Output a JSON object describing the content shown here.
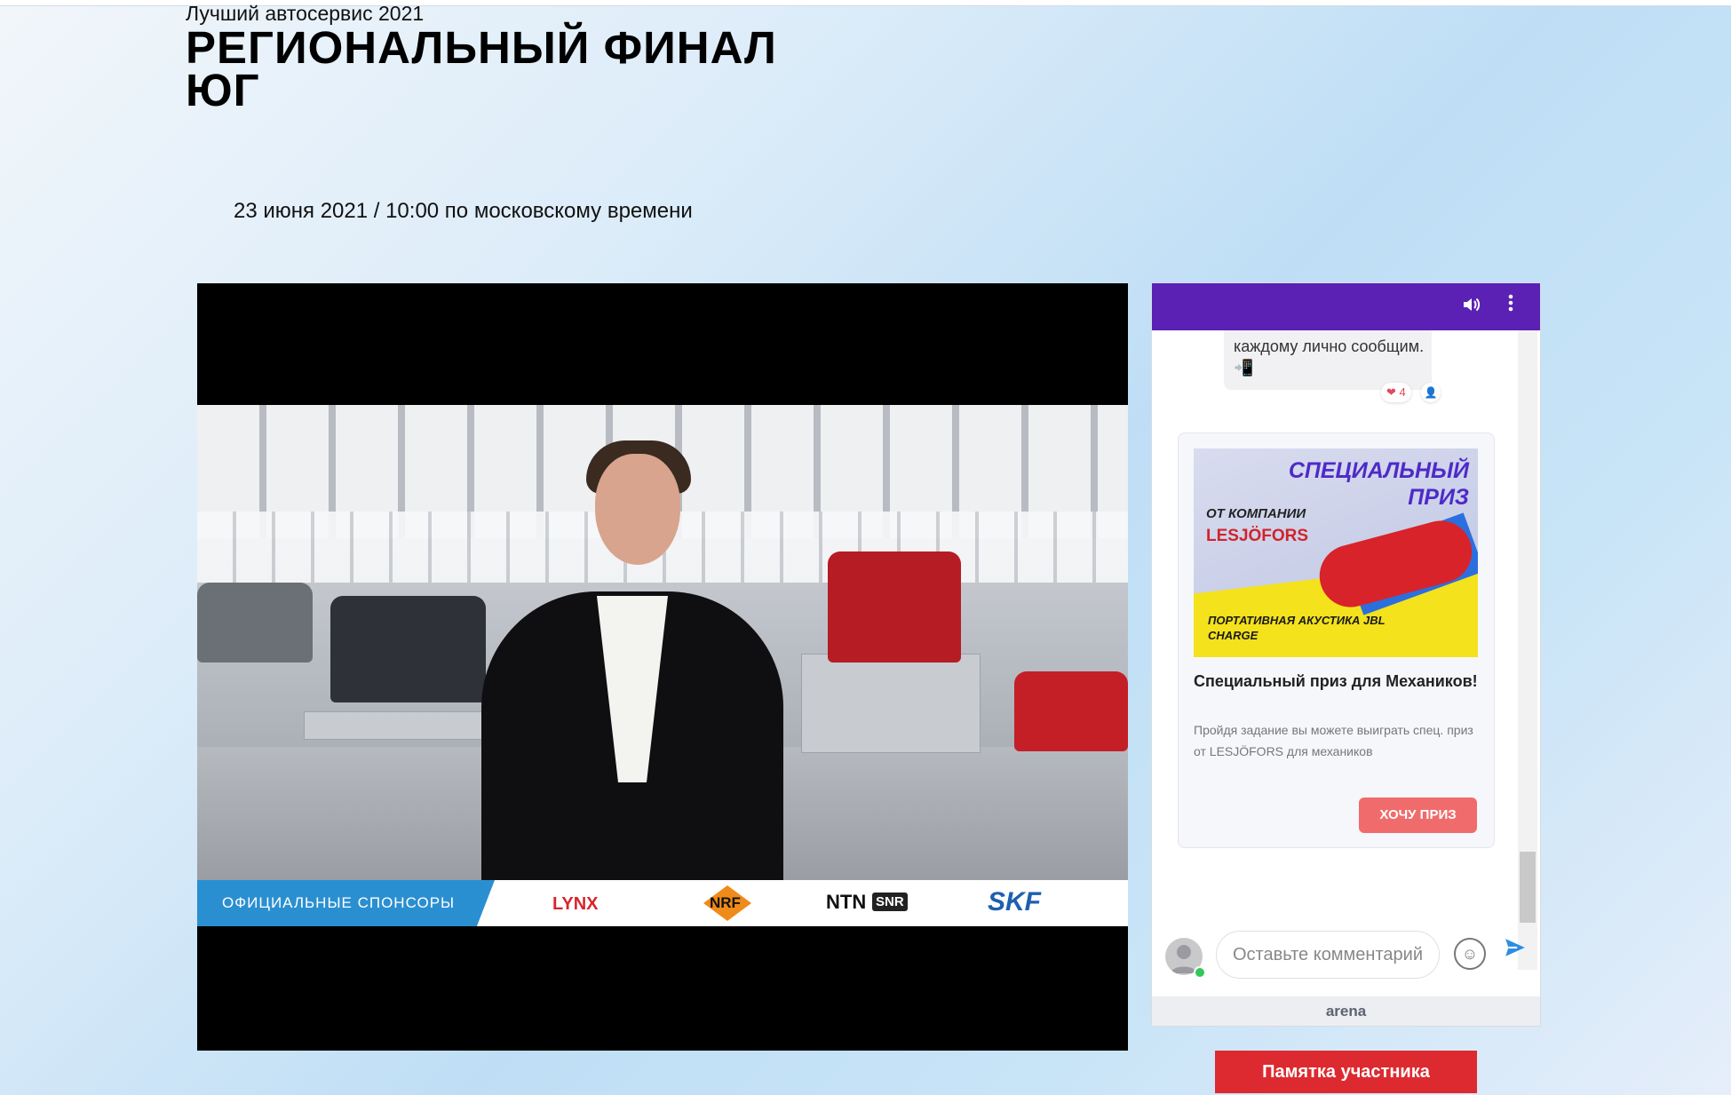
{
  "header": {
    "subtitle": "Лучший автосервис 2021",
    "title": "РЕГИОНАЛЬНЫЙ ФИНАЛ ЮГ",
    "date": "23 июня 2021 / 10:00 по московскому времени"
  },
  "video": {
    "sponsors_label": "ОФИЦИАЛЬНЫЕ СПОНСОРЫ",
    "sponsor_logos": [
      "LYNX",
      "NRF",
      "NTN",
      "SNR",
      "SKF"
    ]
  },
  "chat": {
    "header_icons": [
      "speaker-icon",
      "more-vertical-icon"
    ],
    "message_text": "каждому лично сообщим.",
    "message_reactions": {
      "heart_count": "4"
    },
    "card": {
      "banner_heading": "СПЕЦИАЛЬНЫЙ ПРИЗ",
      "banner_from": "ОТ КОМПАНИИ",
      "banner_brand": "LESJÖFORS",
      "banner_bottom": "ПОРТАТИВНАЯ АКУСТИКА JBL CHARGE",
      "title": "Специальный приз для Механиков!",
      "description": "Пройдя задание вы можете выиграть спец. приз от LESJÖFORS для механиков",
      "button_label": "ХОЧУ ПРИЗ"
    },
    "comment_placeholder": "Оставьте комментарий",
    "footer_brand": "arena"
  },
  "pamyatka_label": "Памятка участника",
  "colors": {
    "chat_header": "#5a21b4",
    "prize_button": "#f06c6c",
    "pamyatka_button": "#dd2a30",
    "sponsor_tag": "#2a8fd1"
  }
}
